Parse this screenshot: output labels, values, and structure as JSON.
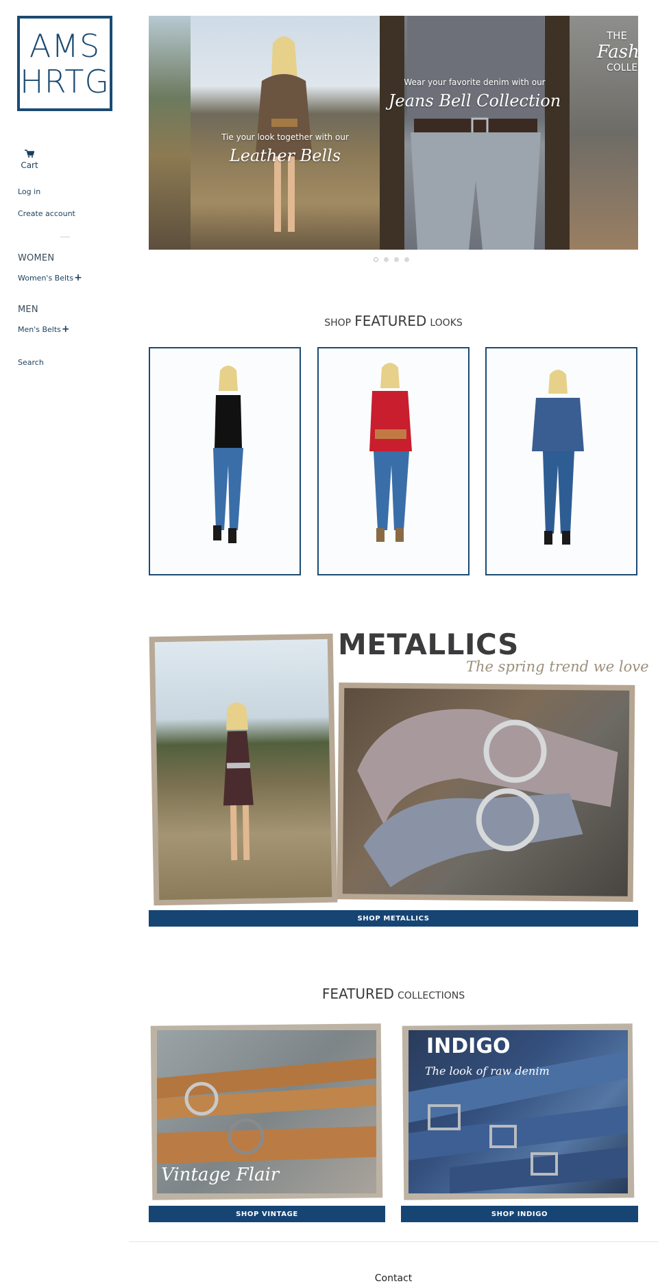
{
  "logo": {
    "line1": "AMS",
    "line2": "HRTG"
  },
  "sidebar": {
    "cart_label": "Cart",
    "login_label": "Log in",
    "create_account_label": "Create account",
    "women_heading": "WOMEN",
    "womens_belts_label": "Women's Belts",
    "men_heading": "MEN",
    "mens_belts_label": "Men's Belts",
    "search_label": "Search",
    "expand_symbol": "+"
  },
  "hero": {
    "slides": [
      {
        "caption_small": "Tie your look together with our",
        "caption_script": "Leather Bells"
      },
      {
        "caption_small": "Wear your favorite denim with our",
        "caption_script": "Jeans Bell Collection"
      },
      {
        "caption_top": "THE",
        "caption_script": "Fashio",
        "caption_bottom": "COLLECTIO"
      }
    ],
    "dots": 4,
    "active_dot": 0
  },
  "featured_looks": {
    "title_prefix": "shop",
    "title_main": "FEATURED",
    "title_suffix": "looks",
    "cards": [
      {
        "name": "look-black-top"
      },
      {
        "name": "look-red-sweater"
      },
      {
        "name": "look-blue-blouse"
      }
    ]
  },
  "metallics": {
    "title": "METALLICS",
    "subtitle": "The spring trend we love",
    "cta": "SHOP METALLICS"
  },
  "featured_collections": {
    "title_main": "FEATURED",
    "title_suffix": "collections",
    "items": [
      {
        "script": "Vintage Flair",
        "cta": "SHOP VINTAGE"
      },
      {
        "title": "INDIGO",
        "script": "The look of raw denim",
        "cta": "SHOP INDIGO"
      }
    ]
  },
  "footer": {
    "title": "Contact"
  },
  "colors": {
    "brand_navy": "#164574",
    "border_navy": "#1b4a72",
    "text": "#1b3e5c"
  }
}
